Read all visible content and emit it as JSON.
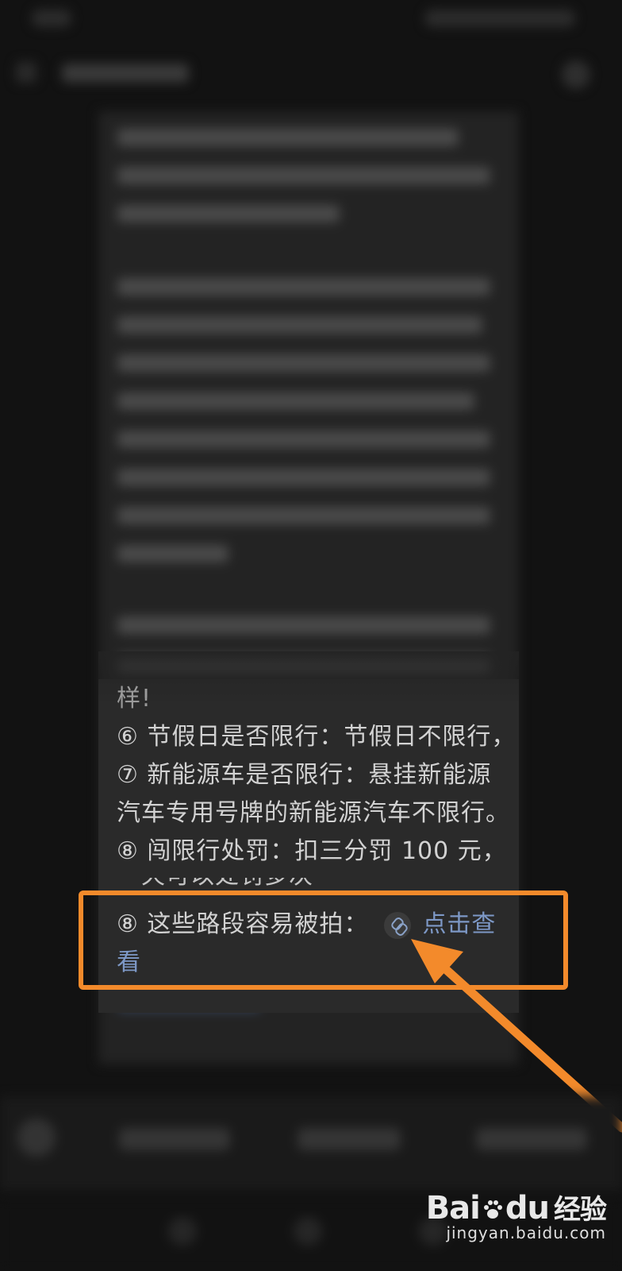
{
  "article": {
    "lines": [
      "样!",
      "⑥ 节假日是否限行：节假日不限行，",
      "⑦ 新能源车是否限行：悬挂新能源",
      "汽车专用号牌的新能源汽车不限行。",
      "⑧ 闯限行处罚：扣三分罚 100 元，"
    ],
    "partial_line": "一天可以处罚多次",
    "link_line_prefix": "⑧ 这些路段容易被拍：",
    "link_label_part1": "点击查",
    "link_label_part2": "看"
  },
  "watermark": {
    "logo_text": "Bai",
    "logo_text_2": "du",
    "logo_suffix": "经验",
    "url": "jingyan.baidu.com"
  },
  "colors": {
    "highlight": "#f38a2b",
    "link": "#7d98c6",
    "background": "#121212"
  },
  "icons": [
    "link-icon",
    "back-icon",
    "share-icon",
    "baidu-paw-icon"
  ]
}
